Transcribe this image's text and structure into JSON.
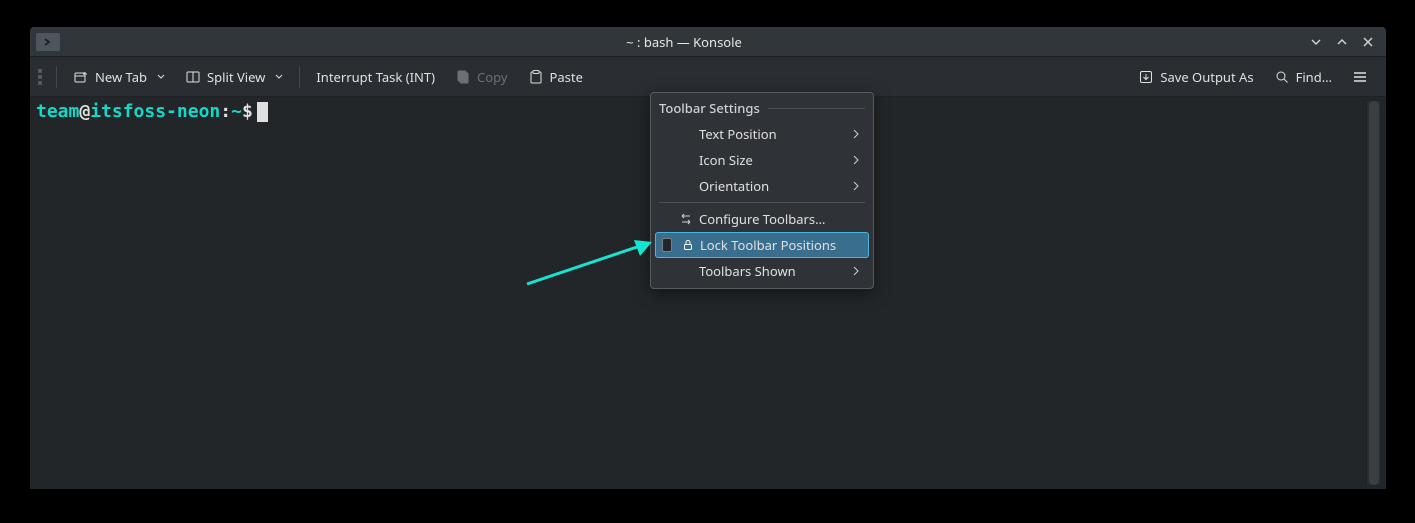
{
  "titlebar": {
    "title": "~ : bash — Konsole"
  },
  "toolbar": {
    "new_tab": "New Tab",
    "split_view": "Split View",
    "interrupt": "Interrupt Task (INT)",
    "copy": "Copy",
    "paste": "Paste",
    "save_output": "Save Output As",
    "find": "Find…"
  },
  "prompt": {
    "user": "team",
    "at": "@",
    "host": "itsfoss-neon",
    "colon": ":",
    "path": "~",
    "symbol": "$"
  },
  "menu": {
    "header": "Toolbar Settings",
    "text_position": "Text Position",
    "icon_size": "Icon Size",
    "orientation": "Orientation",
    "configure": "Configure Toolbars…",
    "lock": "Lock Toolbar Positions",
    "shown": "Toolbars Shown"
  }
}
